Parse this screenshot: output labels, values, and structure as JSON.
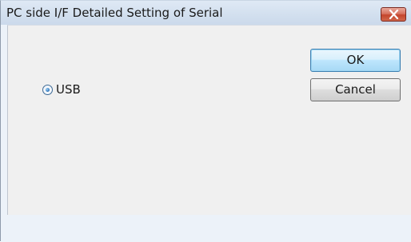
{
  "window": {
    "title": "PC side I/F Detailed Setting of Serial"
  },
  "buttons": {
    "ok_label": "OK",
    "cancel_label": "Cancel"
  },
  "options": {
    "usb_label": "USB",
    "usb_selected": true
  },
  "icons": {
    "close": "close-icon"
  },
  "colors": {
    "titlebar": "#d3e0ef",
    "close_button": "#c4452c",
    "ok_button_highlight": "#bee6fd",
    "client_background": "#f0f0f0"
  }
}
